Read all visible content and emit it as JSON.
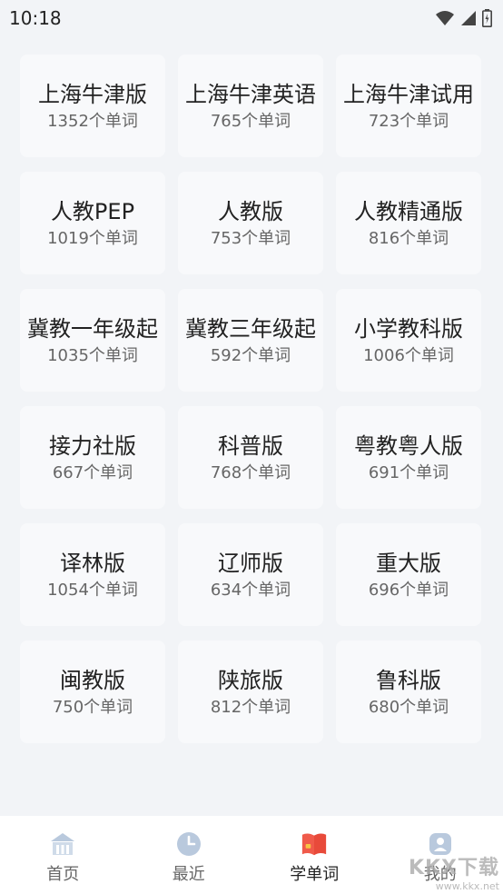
{
  "status_bar": {
    "time": "10:18"
  },
  "books": [
    {
      "title": "上海牛津版",
      "count": "1352个单词"
    },
    {
      "title": "上海牛津英语",
      "count": "765个单词"
    },
    {
      "title": "上海牛津试用",
      "count": "723个单词"
    },
    {
      "title": "人教PEP",
      "count": "1019个单词"
    },
    {
      "title": "人教版",
      "count": "753个单词"
    },
    {
      "title": "人教精通版",
      "count": "816个单词"
    },
    {
      "title": "冀教一年级起",
      "count": "1035个单词"
    },
    {
      "title": "冀教三年级起",
      "count": "592个单词"
    },
    {
      "title": "小学教科版",
      "count": "1006个单词"
    },
    {
      "title": "接力社版",
      "count": "667个单词"
    },
    {
      "title": "科普版",
      "count": "768个单词"
    },
    {
      "title": "粤教粤人版",
      "count": "691个单词"
    },
    {
      "title": "译林版",
      "count": "1054个单词"
    },
    {
      "title": "辽师版",
      "count": "634个单词"
    },
    {
      "title": "重大版",
      "count": "696个单词"
    },
    {
      "title": "闽教版",
      "count": "750个单词"
    },
    {
      "title": "陕旅版",
      "count": "812个单词"
    },
    {
      "title": "鲁科版",
      "count": "680个单词"
    }
  ],
  "tabs": [
    {
      "label": "首页",
      "icon": "home-icon"
    },
    {
      "label": "最近",
      "icon": "clock-icon"
    },
    {
      "label": "学单词",
      "icon": "book-icon",
      "active": true
    },
    {
      "label": "我的",
      "icon": "profile-icon"
    }
  ],
  "watermark": {
    "logo": "KKX下载",
    "url": "www.kkx.net"
  },
  "colors": {
    "accent": "#f05a4a",
    "tab_inactive_icon": "#b9c9dd",
    "background": "#f2f4f7"
  }
}
